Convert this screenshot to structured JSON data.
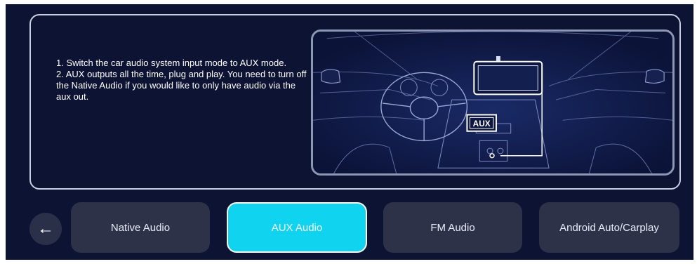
{
  "instructions": {
    "line1": "1. Switch the car audio system input mode to AUX mode.",
    "line2": "2. AUX outputs all the time, plug and play. You need to turn off the Native Audio if you would like to only have audio via the aux out."
  },
  "illustration": {
    "aux_label": "AUX"
  },
  "nav": {
    "back_icon": "left-arrow-icon",
    "back_glyph": "←",
    "tabs": [
      {
        "label": "Native Audio",
        "active": false
      },
      {
        "label": "AUX Audio",
        "active": true
      },
      {
        "label": "FM Audio",
        "active": false
      },
      {
        "label": "Android Auto/Carplay",
        "active": false
      }
    ]
  },
  "colors": {
    "background": "#0c1333",
    "panel_border": "#c9cfe0",
    "tab_inactive": "#2d3249",
    "tab_active": "#0fd3ef",
    "back_button": "#2a3048"
  }
}
